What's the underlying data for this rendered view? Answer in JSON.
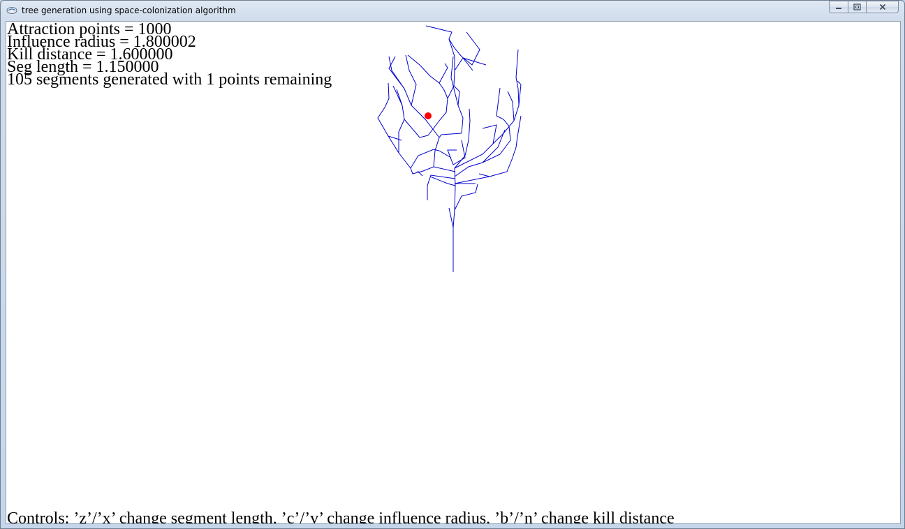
{
  "window": {
    "title": "tree generation using space-colonization algorithm",
    "icon": "app-icon",
    "buttons": {
      "minimize": "minimize-icon",
      "maximize": "maximize-icon",
      "close": "close-icon"
    }
  },
  "stats": {
    "attraction_points": "Attraction points = 1000",
    "influence_radius": "Influence radius = 1.800002",
    "kill_distance": "Kill distance = 1.600000",
    "seg_length": "Seg length = 1.150000",
    "summary": "105 segments generated with 1 points remaining"
  },
  "controls_text": "Controls: ’z’/’x’ change segment length, ’c’/’v’ change influence radius, ’b’/’n’ change kill distance",
  "colors": {
    "branch": "#0000cc",
    "attraction_point": "#ff0000",
    "canvas_background": "#ffffff"
  }
}
